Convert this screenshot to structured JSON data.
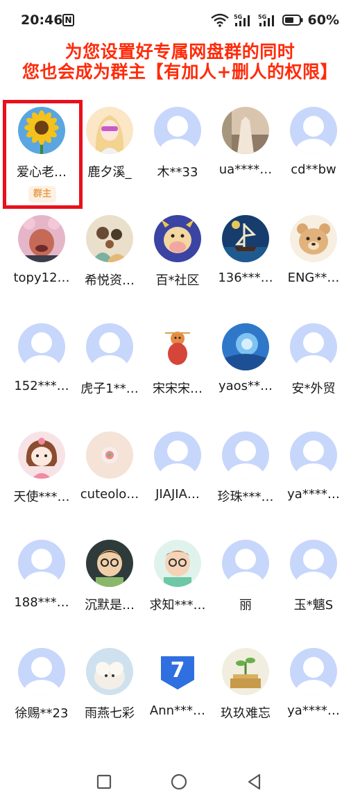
{
  "status_bar": {
    "time": "20:46",
    "nfc": "N",
    "battery": "60%",
    "icons": [
      "nfc-icon",
      "wifi-icon",
      "signal-5g-icon",
      "signal-5g-icon",
      "battery-icon"
    ]
  },
  "headline": {
    "line1": "为您设置好专属网盘群的同时",
    "line2": "您也会成为群主【有加人+删人的权限】"
  },
  "owner_badge": "群主",
  "members": [
    {
      "name": "爱心老…",
      "avatar": "sunflower",
      "owner": true
    },
    {
      "name": "鹿夕溪_",
      "avatar": "anime-girl"
    },
    {
      "name": "木**33",
      "avatar": "default"
    },
    {
      "name": "ua****…",
      "avatar": "scenery-photo"
    },
    {
      "name": "cd**bw",
      "avatar": "default"
    },
    {
      "name": "topy12…",
      "avatar": "pink-hood"
    },
    {
      "name": "希悦资…",
      "avatar": "family-illustration"
    },
    {
      "name": "百*社区",
      "avatar": "cartoon-cow"
    },
    {
      "name": "136***…",
      "avatar": "ship-painting"
    },
    {
      "name": "ENG**…",
      "avatar": "cartoon-bear"
    },
    {
      "name": "152***…",
      "avatar": "default"
    },
    {
      "name": "虎子1**…",
      "avatar": "default"
    },
    {
      "name": "宋宋宋…",
      "avatar": "ornament-figure"
    },
    {
      "name": "yaos**…",
      "avatar": "blue-swirl"
    },
    {
      "name": "安*外贸",
      "avatar": "default"
    },
    {
      "name": "天使***…",
      "avatar": "cartoon-girl"
    },
    {
      "name": "cuteolo…",
      "avatar": "peach-cake"
    },
    {
      "name": "JIAJIA…",
      "avatar": "default"
    },
    {
      "name": "珍珠***…",
      "avatar": "default"
    },
    {
      "name": "ya****…",
      "avatar": "default"
    },
    {
      "name": "188***…",
      "avatar": "default"
    },
    {
      "name": "沉默是…",
      "avatar": "glasses-boy-dark"
    },
    {
      "name": "求知***…",
      "avatar": "glasses-boy-light"
    },
    {
      "name": "丽",
      "avatar": "default"
    },
    {
      "name": "玉*魑S",
      "avatar": "default"
    },
    {
      "name": "徐赐**23",
      "avatar": "default"
    },
    {
      "name": "雨燕七彩",
      "avatar": "lamb-photo"
    },
    {
      "name": "Ann***…",
      "avatar": "app-logo-7"
    },
    {
      "name": "玖玖难忘",
      "avatar": "sprout-coins"
    },
    {
      "name": "ya****…",
      "avatar": "default"
    }
  ],
  "nav": {
    "recent": "recent-apps-icon",
    "home": "home-icon",
    "back": "back-icon"
  },
  "colors": {
    "headline": "#ff2b0a",
    "highlight": "#e8101b",
    "badge_bg": "#fdf1e4",
    "badge_text": "#e7a04f",
    "default_avatar": "#c7d6fb"
  }
}
